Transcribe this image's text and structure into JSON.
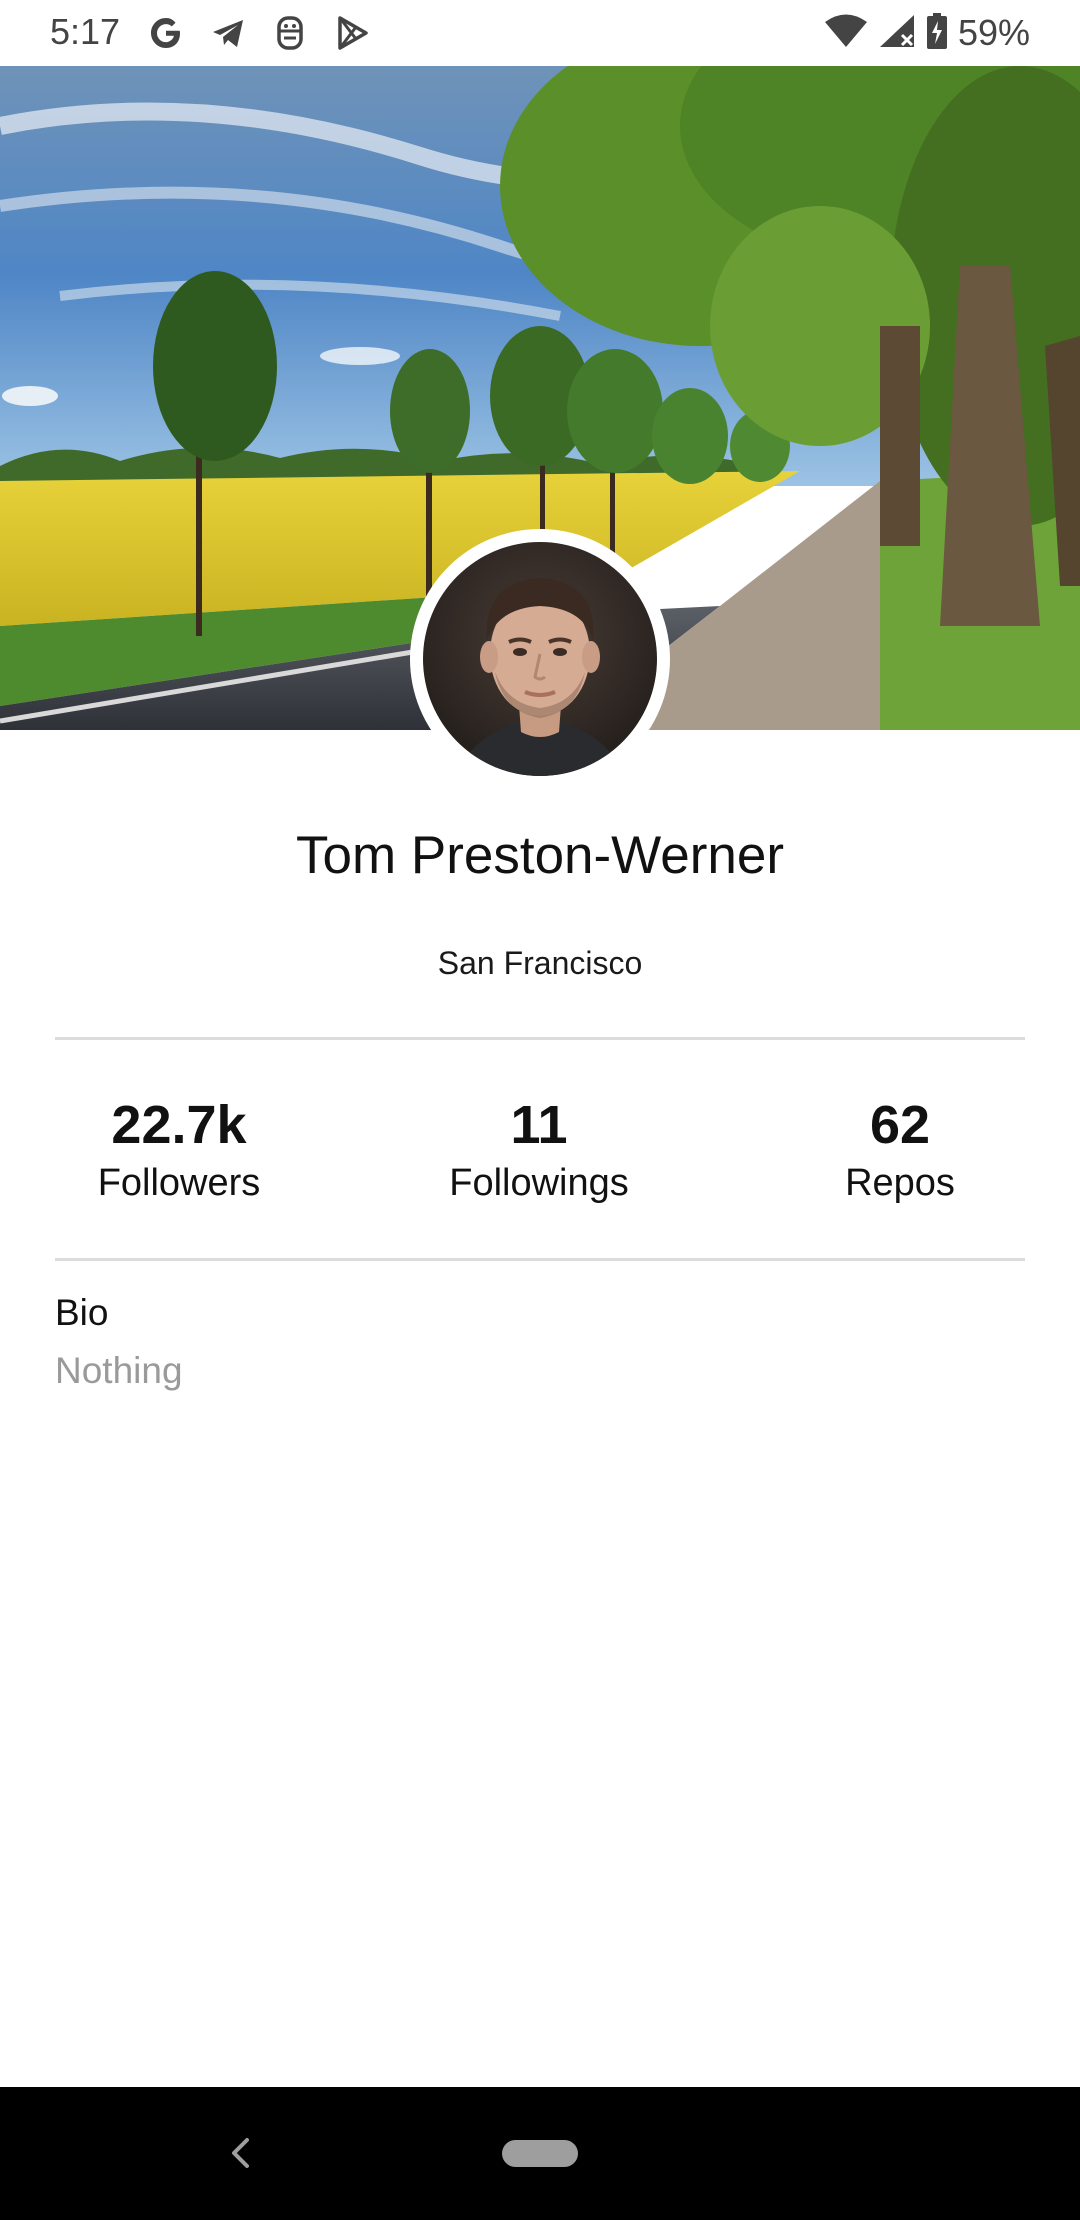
{
  "status_bar": {
    "time": "5:17",
    "battery_percent": "59%",
    "left_icons": [
      "google-icon",
      "telegram-icon",
      "assistant-icon",
      "play-store-icon"
    ],
    "right_icons": [
      "wifi-icon",
      "cellular-no-signal-icon",
      "battery-charging-icon"
    ]
  },
  "profile": {
    "name": "Tom Preston-Werner",
    "location": "San Francisco",
    "cover_image": "cover-photo",
    "avatar_image": "avatar"
  },
  "stats": [
    {
      "value": "22.7k",
      "label": "Followers"
    },
    {
      "value": "11",
      "label": "Followings"
    },
    {
      "value": "62",
      "label": "Repos"
    }
  ],
  "bio": {
    "label": "Bio",
    "value": "Nothing"
  },
  "nav_bar": {
    "icons": [
      "back-icon",
      "home-pill-icon"
    ]
  },
  "colors": {
    "background": "#ffffff",
    "text_primary": "#111111",
    "text_muted": "#9a9a9a",
    "divider": "#dcdcdc",
    "nav_bar": "#000000"
  }
}
